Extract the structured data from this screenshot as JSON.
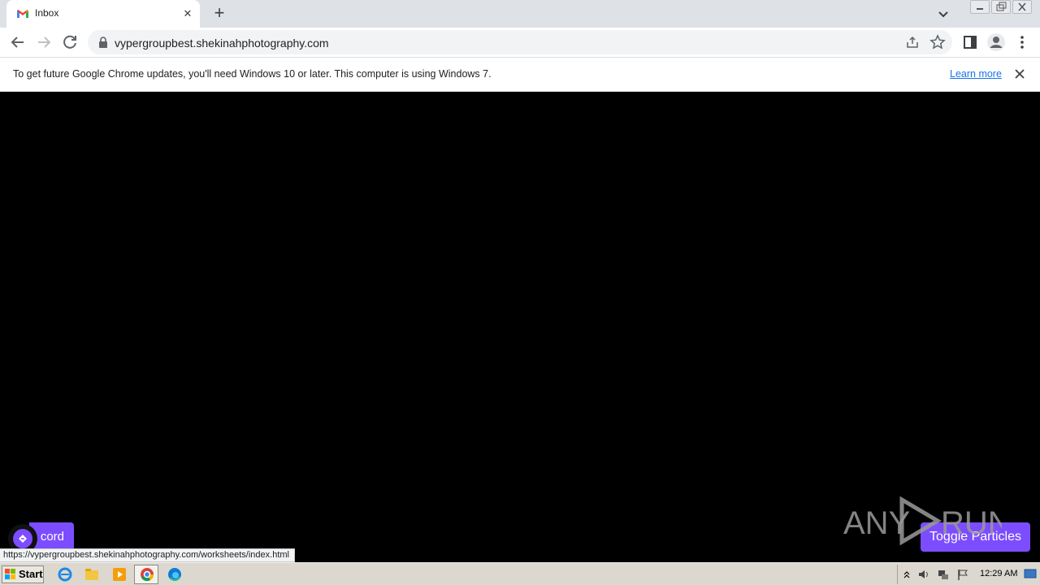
{
  "browser": {
    "tab_title": "Inbox",
    "tab_close": "✕",
    "new_tab": "+",
    "url": "vypergroupbest.shekinahphotography.com"
  },
  "infobar": {
    "message": "To get future Google Chrome updates, you'll need Windows 10 or later. This computer is using Windows 7.",
    "learn_more": "Learn more"
  },
  "page": {
    "left_button_label": "cord",
    "right_button_label": "Toggle Particles",
    "accent_color": "#7c4dff",
    "background_color": "#000000"
  },
  "status_bar": {
    "link_url": "https://vypergroupbest.shekinahphotography.com/worksheets/index.html"
  },
  "watermark": {
    "text_left": "ANY",
    "text_right": "RUN"
  },
  "taskbar": {
    "start_label": "Start",
    "clock": "12:29 AM",
    "pinned": [
      "internet-explorer-icon",
      "file-explorer-icon",
      "media-player-icon",
      "chrome-icon",
      "edge-icon"
    ]
  }
}
